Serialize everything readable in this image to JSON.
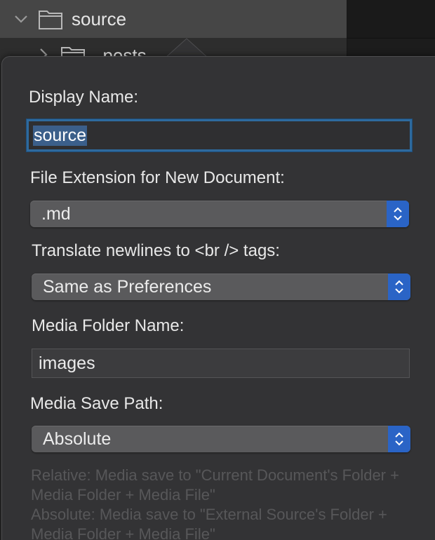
{
  "sidebar": {
    "items": [
      {
        "label": "source",
        "expanded": true,
        "selected": true
      },
      {
        "label": "_posts",
        "expanded": false,
        "selected": false
      }
    ]
  },
  "popover": {
    "display_name": {
      "label": "Display Name:",
      "value": "source"
    },
    "file_extension": {
      "label": "File Extension for New Document:",
      "value": ".md"
    },
    "translate_newlines": {
      "label": "Translate newlines to <br /> tags:",
      "value": "Same as Preferences"
    },
    "media_folder": {
      "label": "Media Folder Name:",
      "value": "images"
    },
    "media_save_path": {
      "label": "Media Save Path:",
      "value": "Absolute"
    },
    "hint": {
      "relative": "Relative: Media save to \"Current Document's Folder + Media Folder + Media File\"",
      "absolute": "Absolute: Media save to \"External Source's Folder + Media Folder + Media File\""
    }
  },
  "colors": {
    "accent": "#2a64c6",
    "focus_ring": "#2e6a9e",
    "popover_bg": "#333335"
  },
  "icons": [
    "chevron-down-icon",
    "chevron-right-icon",
    "folder-icon",
    "up-down-chevron-icon"
  ]
}
